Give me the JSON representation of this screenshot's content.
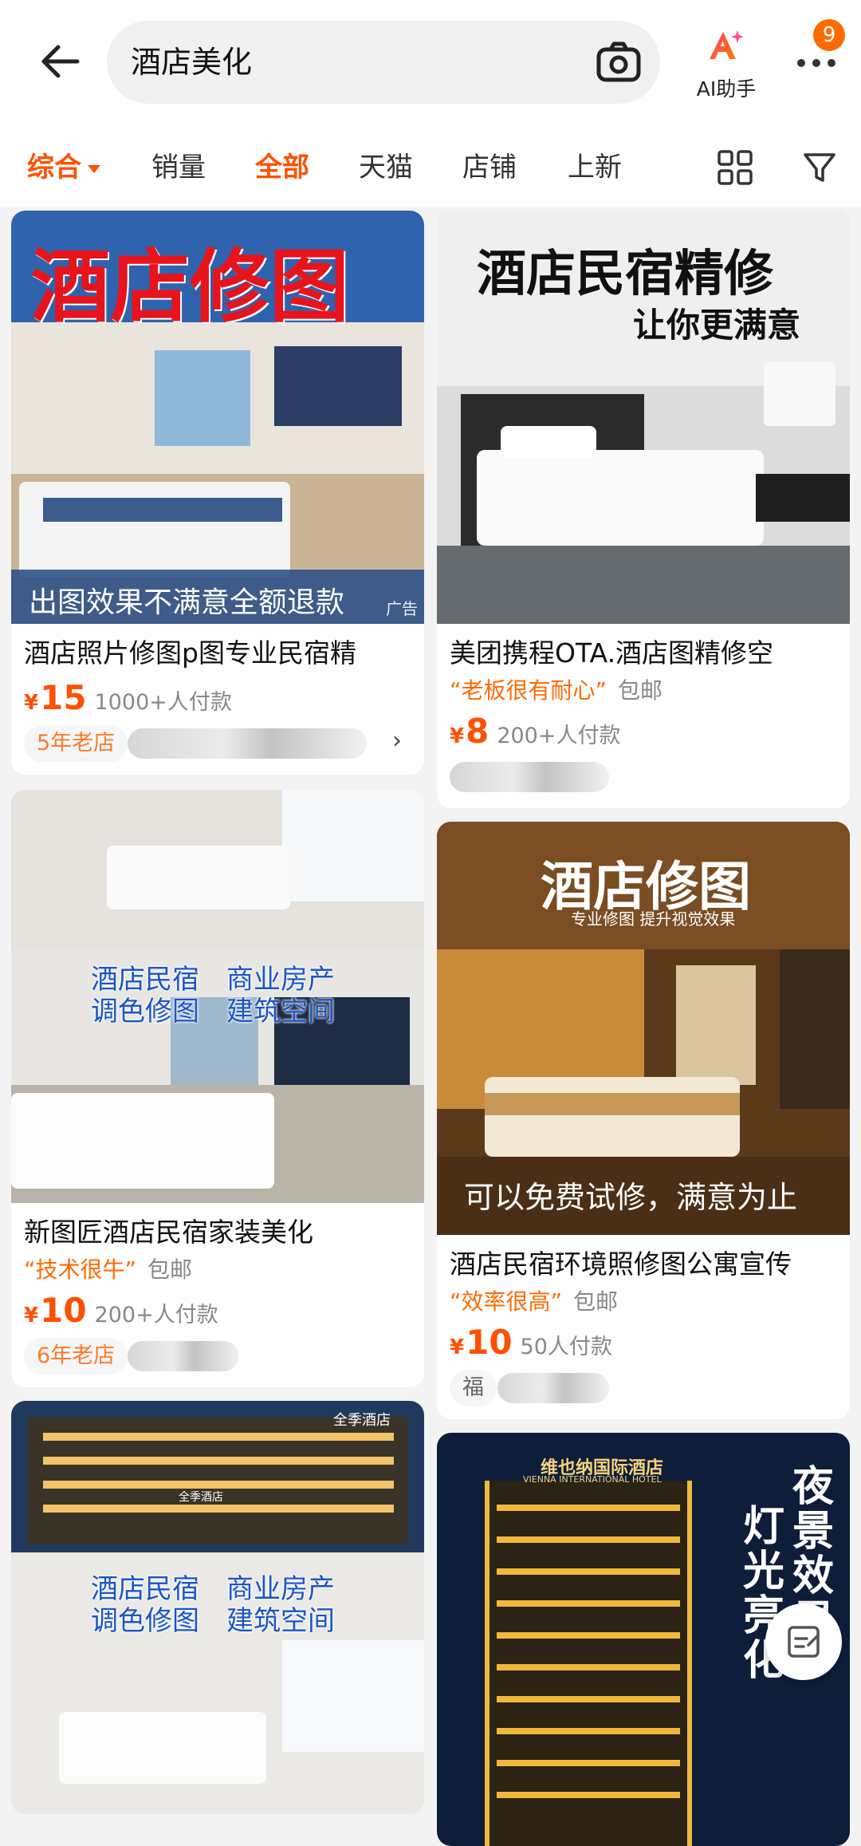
{
  "header": {
    "search_query": "酒店美化",
    "ai_label": "AI助手",
    "message_badge": "9"
  },
  "tabs": [
    {
      "label": "综合",
      "active": true
    },
    {
      "label": "销量",
      "active": false
    },
    {
      "label": "全部",
      "active": true
    },
    {
      "label": "天猫",
      "active": false
    },
    {
      "label": "店铺",
      "active": false
    },
    {
      "label": "上新",
      "active": false
    }
  ],
  "products": [
    {
      "title": "酒店照片修图p图专业民宿精",
      "image_text": [
        "酒店修图",
        "出图效果不满意全额退款"
      ],
      "ad_mark": "广告",
      "price_symbol": "¥",
      "price": "15",
      "sales": "1000+人付款",
      "shop_tag": "5年老店"
    },
    {
      "title": "美团携程OTA.酒店图精修空",
      "image_text": [
        "酒店民宿精修",
        "让你更满意"
      ],
      "tagline": "“老板很有耐心”",
      "shipping": "包邮",
      "price_symbol": "¥",
      "price": "8",
      "sales": "200+人付款"
    },
    {
      "title": "新图匠酒店民宿家装美化",
      "image_text": [
        "酒店民宿",
        "调色修图",
        "商业房产",
        "建筑空间"
      ],
      "tagline": "“技术很牛”",
      "shipping": "包邮",
      "price_symbol": "¥",
      "price": "10",
      "sales": "200+人付款",
      "shop_tag": "6年老店"
    },
    {
      "title": "酒店民宿环境照修图公寓宣传",
      "image_text": [
        "酒店修图",
        "专业修图 提升视觉效果",
        "可以免费试修，满意为止"
      ],
      "tagline": "“效率很高”",
      "shipping": "包邮",
      "price_symbol": "¥",
      "price": "10",
      "sales": "50人付款",
      "shop_tag": "福"
    },
    {
      "image_text": [
        "全季酒店",
        "酒店民宿",
        "调色修图",
        "商业房产",
        "建筑空间",
        "全季酒店"
      ]
    },
    {
      "image_text": [
        "维也纳国际酒店",
        "VIENNA INTERNATIONAL HOTEL",
        "夜景效果",
        "灯光亮化"
      ]
    }
  ],
  "colors": {
    "accent": "#ff5000",
    "tag_orange": "#ff6a00"
  }
}
